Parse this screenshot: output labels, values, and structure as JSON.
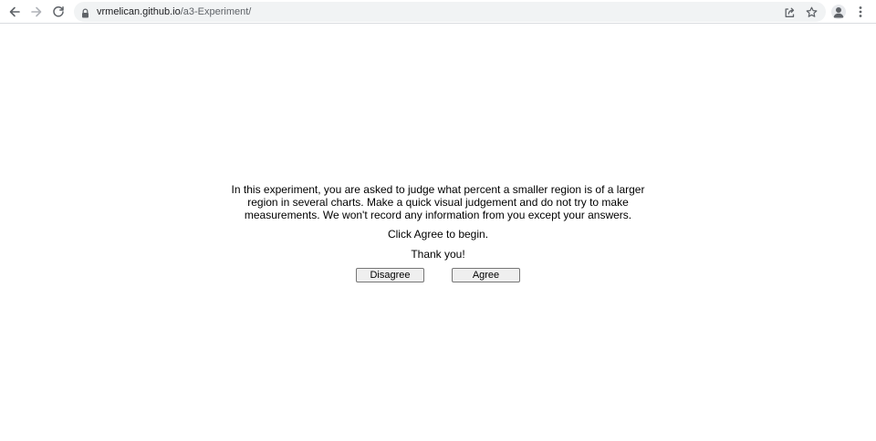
{
  "browser": {
    "url_host": "vrmelican.github.io",
    "url_path": "/a3-Experiment/",
    "icons": {
      "back": "arrow-left",
      "forward": "arrow-right",
      "reload": "reload",
      "site_info": "lock",
      "share": "share",
      "bookmark": "star",
      "profile": "person",
      "menu": "three-dots-vertical"
    }
  },
  "page": {
    "intro": "In this experiment, you are asked to judge what percent a smaller region is of a larger region in several charts. Make a quick visual judgement and do not try to make measurements. We won't record any information from you except your answers.",
    "instruction": "Click Agree to begin.",
    "thanks": "Thank you!",
    "disagree_label": "Disagree",
    "agree_label": "Agree"
  }
}
